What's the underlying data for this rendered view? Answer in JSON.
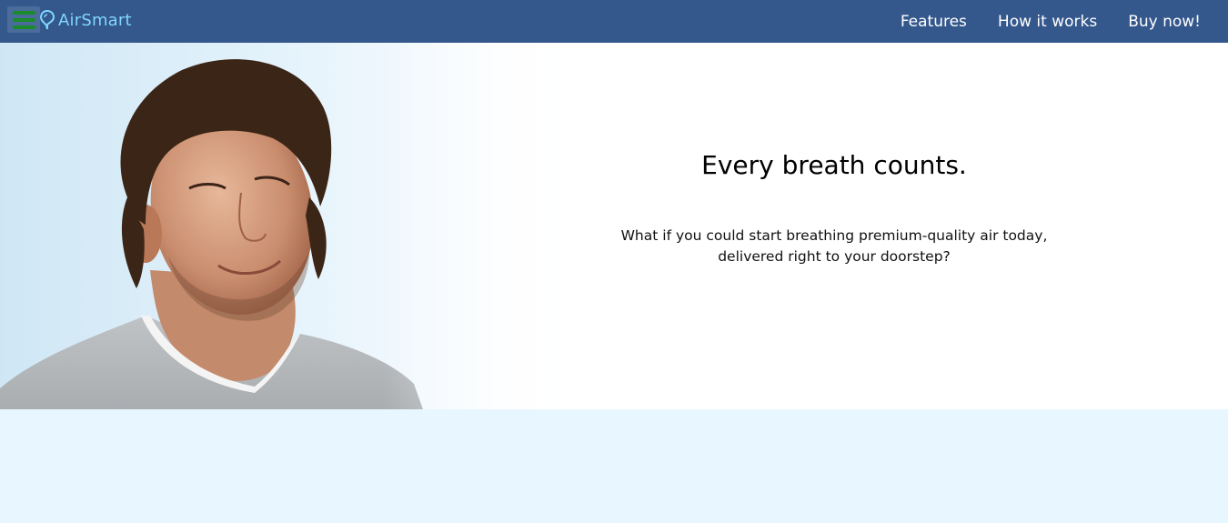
{
  "navbar": {
    "brand": "AirSmart",
    "links": [
      "Features",
      "How it works",
      "Buy now!"
    ],
    "background_color": "#34578c",
    "brand_color": "#7fd6ff"
  },
  "hero": {
    "title": "Every breath counts.",
    "subtitle": "What if you could start breathing premium-quality air today, delivered right to your doorstep?",
    "photo": "man-breathing-fresh-air-photo"
  },
  "lower_section": {
    "background_color": "#e8f6ff"
  }
}
